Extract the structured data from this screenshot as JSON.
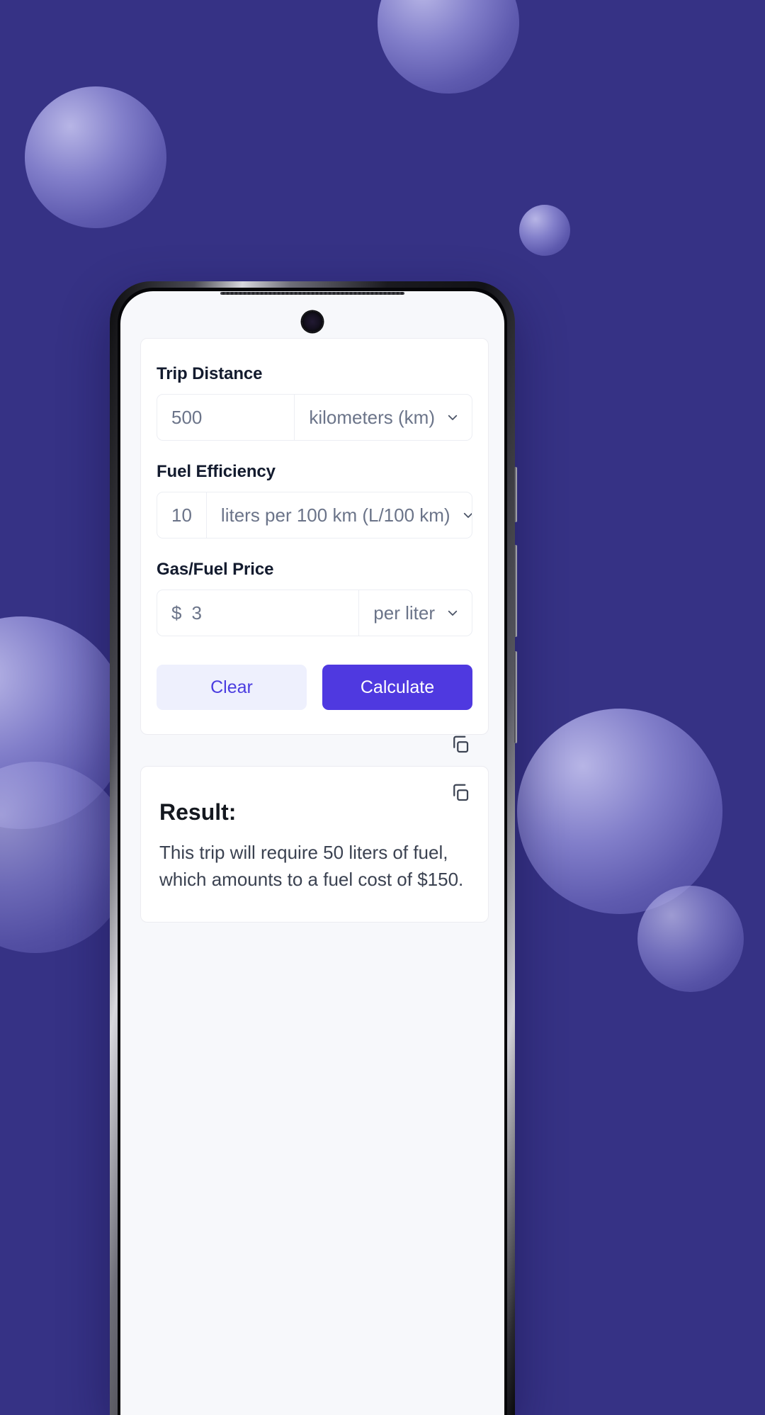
{
  "theme": {
    "background_color": "#363285",
    "accent_color": "#4f39e0",
    "accent_soft_color": "#eef0fd",
    "screen_background": "#f7f8fb"
  },
  "form": {
    "fields": [
      {
        "label": "Trip Distance",
        "value": "500",
        "unit": "kilometers (km)",
        "prefix": ""
      },
      {
        "label": "Fuel Efficiency",
        "value": "10",
        "unit": "liters per 100 km (L/100 km)",
        "prefix": ""
      },
      {
        "label": "Gas/Fuel Price",
        "value": "3",
        "unit": "per liter",
        "prefix": "$"
      }
    ],
    "buttons": {
      "clear_label": "Clear",
      "calculate_label": "Calculate"
    }
  },
  "result": {
    "title": "Result:",
    "text": "This trip will require 50 liters of fuel, which amounts to a fuel cost of $150.",
    "copy_icon_name": "copy-icon"
  },
  "icons": {
    "chevron_down": "chevron-down-icon",
    "camera": "front-camera",
    "speaker": "earpiece-speaker"
  }
}
